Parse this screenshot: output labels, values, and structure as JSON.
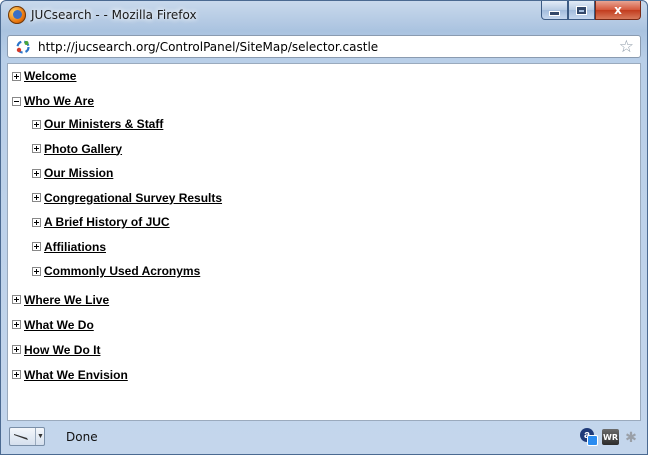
{
  "window": {
    "title": "JUCsearch - - Mozilla Firefox",
    "caption": {
      "close": "x"
    }
  },
  "address_bar": {
    "url": "http://jucsearch.org/ControlPanel/SiteMap/selector.castle"
  },
  "sitemap": {
    "items": [
      {
        "label": "Welcome",
        "state": "collapsed"
      },
      {
        "label": "Who We Are",
        "state": "expanded",
        "children": [
          {
            "label": "Our Ministers & Staff",
            "state": "collapsed"
          },
          {
            "label": "Photo Gallery",
            "state": "collapsed"
          },
          {
            "label": "Our Mission",
            "state": "collapsed"
          },
          {
            "label": "Congregational Survey Results",
            "state": "collapsed"
          },
          {
            "label": "A Brief History of JUC",
            "state": "collapsed"
          },
          {
            "label": "Affiliations",
            "state": "collapsed"
          },
          {
            "label": "Commonly Used Acronyms",
            "state": "collapsed"
          }
        ]
      },
      {
        "label": "Where We Live",
        "state": "collapsed"
      },
      {
        "label": "What We Do",
        "state": "collapsed"
      },
      {
        "label": "How We Do It",
        "state": "collapsed"
      },
      {
        "label": "What We Envision",
        "state": "collapsed"
      }
    ]
  },
  "status_bar": {
    "text": "Done",
    "addon_a_letter": "a",
    "addon_wr_label": "WR"
  },
  "colors": {
    "titlebar": "#b9cfe8",
    "close_button": "#c23c1e",
    "link": "#000000"
  }
}
